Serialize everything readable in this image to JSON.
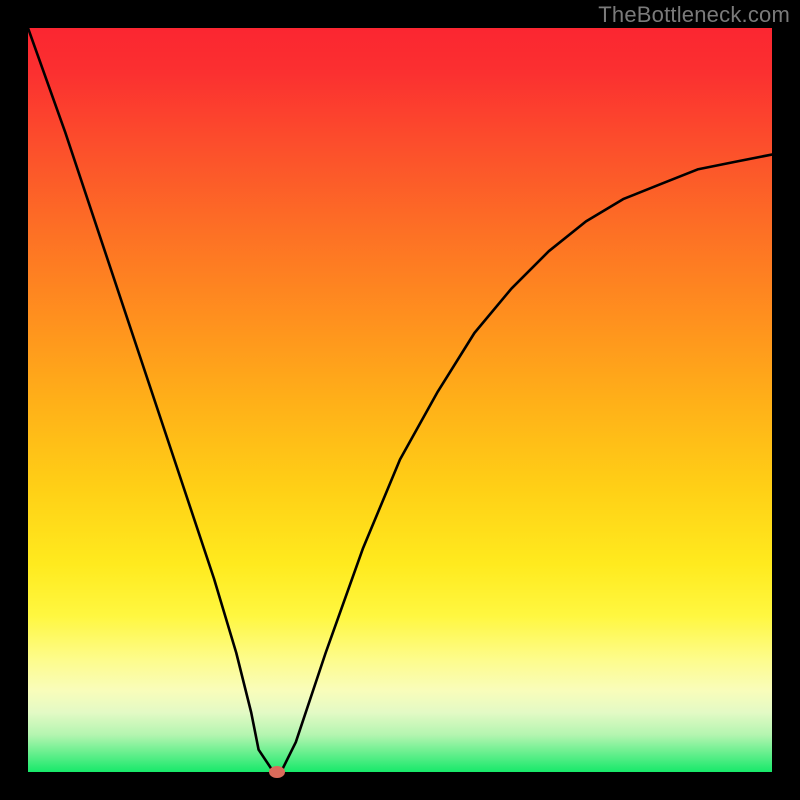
{
  "watermark": "TheBottleneck.com",
  "chart_data": {
    "type": "line",
    "title": "",
    "xlabel": "",
    "ylabel": "",
    "xlim": [
      0,
      100
    ],
    "ylim": [
      0,
      100
    ],
    "series": [
      {
        "name": "curve",
        "x": [
          0,
          5,
          10,
          15,
          20,
          25,
          28,
          30,
          31,
          33,
          34,
          36,
          40,
          45,
          50,
          55,
          60,
          65,
          70,
          75,
          80,
          85,
          90,
          95,
          100
        ],
        "y": [
          100,
          86,
          71,
          56,
          41,
          26,
          16,
          8,
          3,
          0,
          0,
          4,
          16,
          30,
          42,
          51,
          59,
          65,
          70,
          74,
          77,
          79,
          81,
          82,
          83
        ]
      }
    ],
    "marker": {
      "x": 33.5,
      "y": 0
    },
    "background_gradient": {
      "stops": [
        {
          "pos": 0,
          "color": "#fb2631"
        },
        {
          "pos": 15,
          "color": "#fc4c2c"
        },
        {
          "pos": 39,
          "color": "#ff901e"
        },
        {
          "pos": 62,
          "color": "#ffd016"
        },
        {
          "pos": 79,
          "color": "#fff740"
        },
        {
          "pos": 92,
          "color": "#e3fac5"
        },
        {
          "pos": 100,
          "color": "#17e96a"
        }
      ]
    }
  },
  "colors": {
    "frame": "#000000",
    "curve": "#000000",
    "marker": "#da6b5b",
    "watermark": "#7a7a7a"
  }
}
